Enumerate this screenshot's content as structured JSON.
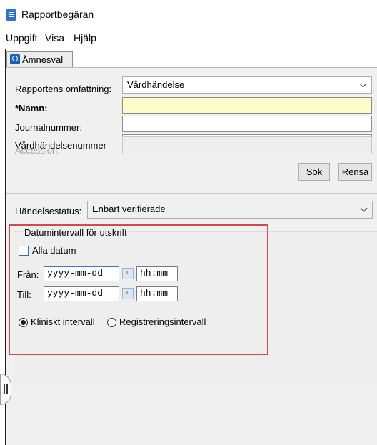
{
  "window": {
    "title": "Rapportbegäran"
  },
  "menu": {
    "items": [
      "Uppgift",
      "Visa",
      "Hjälp"
    ]
  },
  "tabs": {
    "active": "Ämnesval"
  },
  "form": {
    "scope_label": "Rapportens omfattning:",
    "scope_value": "Vårdhändelse",
    "name_label": "*Namn:",
    "name_value": "",
    "journal_label": "Journalnummer:",
    "journal_value": "",
    "event_number_label": "Vårdhändelsenummer",
    "event_number_value": "",
    "accession_label": "Accession:",
    "accession_value": "",
    "search_button": "Sök",
    "clear_button": "Rensa"
  },
  "status": {
    "label": "Händelsestatus:",
    "value": "Enbart verifierade"
  },
  "date_interval": {
    "group_title": "Datumintervall för utskrift",
    "all_dates_label": "Alla datum",
    "all_dates_checked": false,
    "from_label": "Från:",
    "to_label": "Till:",
    "date_placeholder": "yyyy-mm-dd",
    "time_placeholder": "hh:mm",
    "radio_clinical": "Kliniskt intervall",
    "radio_registration": "Registreringsintervall",
    "selected": "clinical"
  },
  "colors": {
    "name_field_bg": "#fdfbc8",
    "highlight_border": "#d24a4a",
    "panel_bg": "#f0f0f0"
  }
}
